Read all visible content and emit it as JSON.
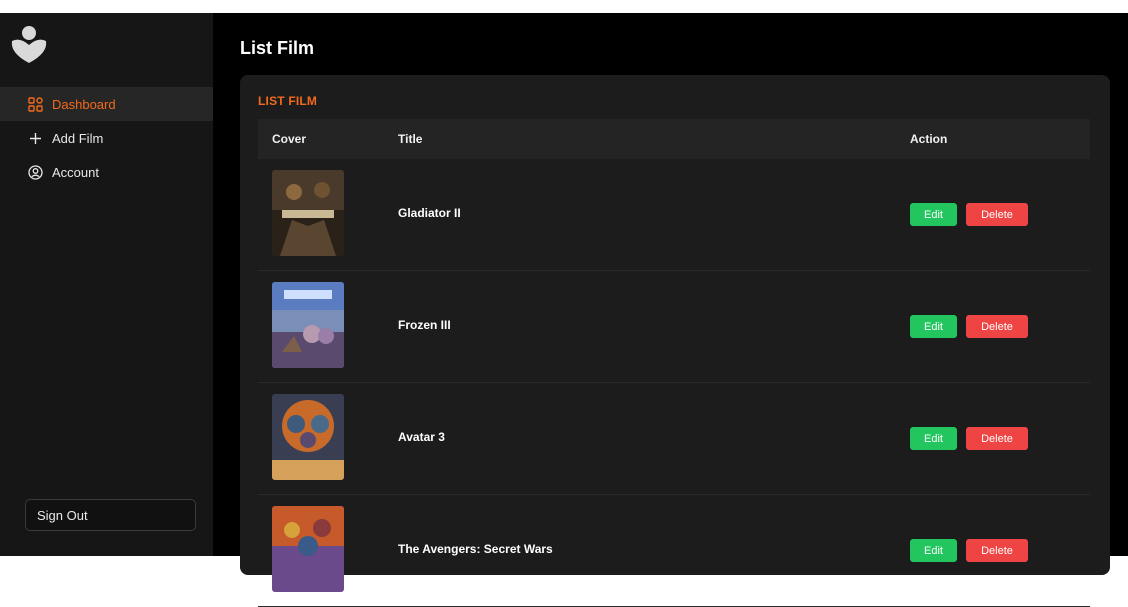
{
  "sidebar": {
    "items": [
      {
        "label": "Dashboard",
        "icon": "dashboard-grid-icon",
        "active": true
      },
      {
        "label": "Add Film",
        "icon": "plus-icon",
        "active": false
      },
      {
        "label": "Account",
        "icon": "user-circle-icon",
        "active": false
      }
    ],
    "sign_out": "Sign Out"
  },
  "main": {
    "title": "List Film",
    "panel_title": "LIST FILM",
    "columns": {
      "cover": "Cover",
      "title": "Title",
      "action": "Action"
    },
    "films": [
      {
        "title": "Gladiator II",
        "cover_colors": [
          "#4a3a2c",
          "#8c6a3e",
          "#2a2218"
        ]
      },
      {
        "title": "Frozen III",
        "cover_colors": [
          "#6b8fc7",
          "#b79ab0",
          "#5a4a6e"
        ]
      },
      {
        "title": "Avatar 3",
        "cover_colors": [
          "#c76a2a",
          "#3a3e52",
          "#d4a05a"
        ]
      },
      {
        "title": "The Avengers: Secret Wars",
        "cover_colors": [
          "#c65a2a",
          "#6a4a8a",
          "#d6a23a"
        ]
      }
    ],
    "edit_label": "Edit",
    "delete_label": "Delete"
  },
  "colors": {
    "accent": "#f26a1b",
    "edit": "#22c55e",
    "delete": "#ef4444"
  }
}
